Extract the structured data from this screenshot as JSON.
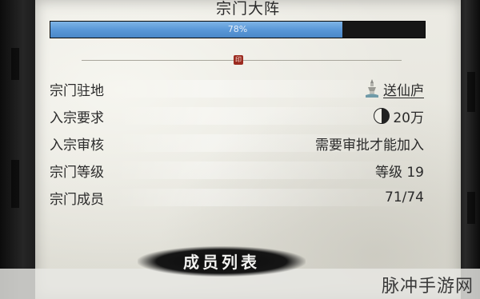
{
  "panel": {
    "title": "宗门大阵",
    "progress": {
      "label": "78%",
      "value": 0.78
    }
  },
  "info_rows": [
    {
      "label": "宗门驻地",
      "value": "送仙庐",
      "icon": "tower-icon"
    },
    {
      "label": "入宗要求",
      "value": "20万",
      "icon": "taiji-icon"
    },
    {
      "label": "入宗审核",
      "value": "需要审批才能加入"
    },
    {
      "label": "宗门等级",
      "value": "等级 19"
    },
    {
      "label": "宗门成员",
      "value": "71/74"
    }
  ],
  "member_list_button": "成员列表",
  "watermark": "脉冲手游网",
  "colors": {
    "progress_fill": "#5a98d8",
    "progress_track": "#161616",
    "parchment": "#e6e5dd",
    "seal": "#9c2b20"
  }
}
